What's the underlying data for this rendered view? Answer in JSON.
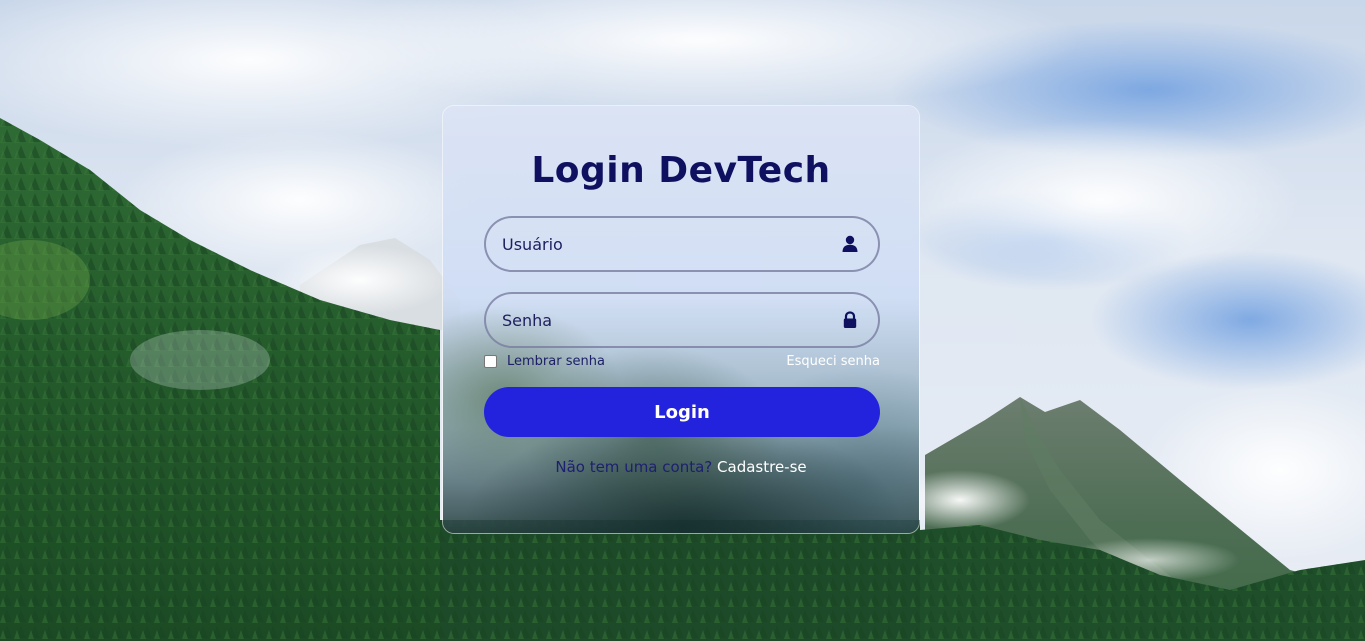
{
  "login": {
    "title": "Login DevTech",
    "username_placeholder": "Usuário",
    "password_placeholder": "Senha",
    "remember_label": "Lembrar senha",
    "forgot_label": "Esqueci senha",
    "button_label": "Login",
    "no_account_text": "Não tem uma conta?",
    "register_link": "Cadastre-se"
  },
  "icons": {
    "username": "user-icon",
    "password": "lock-icon"
  },
  "colors": {
    "title": "#0f1160",
    "button": "#2323dd",
    "button_text": "#ffffff",
    "link": "#ffffff"
  }
}
